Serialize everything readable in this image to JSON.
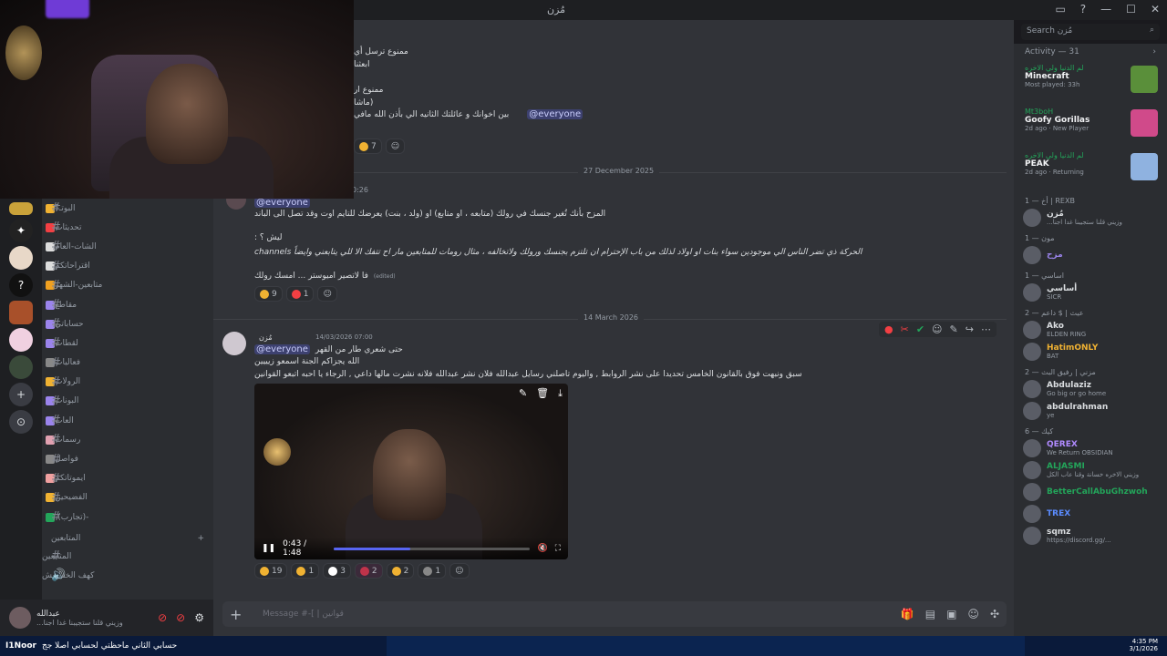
{
  "window": {
    "title": "مُزن",
    "search_placeholder": "Search مُزن"
  },
  "messages": {
    "m1_line1": "ممنوع ترسل أي",
    "m1_line2": "ابعثنا",
    "m1_line3": "ممنوع ار",
    "m1_line4": "(ماشا",
    "m1_line5": "بين اخوانك و عائلتك الثانيه الي بأذن الله مافي",
    "m1_mention": "@everyone",
    "m1_reaction_count": "7",
    "date1": "27 December 2025",
    "m2_time": "0:26",
    "m2_mention": "@everyone",
    "m2_line1": "المزح بأنك تُغير جنسك في رولك (متابعه ، او متابع) او (ولد ، بنت) يعرضك للتايم اوت وقد تصل الى الباند",
    "m2_line2": "ليش ؟ :",
    "m2_line3": "الحركة ذي تضر الناس الي موجودين سواء بنات او اولاد لذلك من باب الإحترام ان تلتزم بجنسك ورولك ولاتخالفه ، مثال رومات للمتابعين مار اح تتفك الا للي يتابعني وايضاً channels",
    "m2_line4": "فا لاتصير اميوستر ... امسك رولك",
    "m2_edited": "(edited)",
    "m2_reactions": [
      "9",
      "1"
    ],
    "date2": "14 March 2026",
    "m3_author": "مُزن",
    "m3_timestamp": "14/03/2026 07:00",
    "m3_line1": "حتى شعري طار من القهر",
    "m3_mention": "@everyone",
    "m3_line2": "الله يجزاكم الجنة اسمعو زيييين",
    "m3_line3": "سبق ونبهت فوق بالقانون الخامس تحديدا على نشر الروابط , واليوم تاصلني رسايل عبدالله فلان نشر عبدالله فلانه نشرت مالها داعي , الرجاء يا احبه اتبعو القوانين",
    "m3_reactions": [
      "19",
      "1",
      "3",
      "2",
      "2",
      "1"
    ]
  },
  "video": {
    "time": "0:43 / 1:48",
    "progress": 0.39
  },
  "composer": {
    "placeholder": "Message #-[ | قوانين"
  },
  "channels": [
    "البوتـ؟",
    "تحديثات",
    "الشات-العام",
    "اقتراحاتكم",
    "متابعين-الشهر",
    "مقاطع",
    "حساباتي",
    "لقطات",
    "فعاليات",
    "الرولات",
    "البونات",
    "العاب",
    "رسمات",
    "فواصل",
    "ايموتاتكم",
    "الفضيحين",
    "-(تجارب)-"
  ],
  "category": "المتابعين",
  "channels2": [
    "المتابعين",
    "كهف الخفافيش"
  ],
  "user": {
    "name": "عبدالله",
    "status": "...وزيني قلنا ستجيبنا غدا اجنا"
  },
  "sidebar": {
    "activity_header": "Activity — 31",
    "activities": [
      {
        "name": "لم الدنيا ولي الاخره",
        "game": "Minecraft",
        "meta": "Most played: 33h",
        "color": "#5a8f3a"
      },
      {
        "name": "Mt3boH",
        "game": "Goofy Gorillas",
        "meta": "2d ago · New Player",
        "color": "#d04a8a"
      },
      {
        "name": "لم الدنيا ولي الاخره",
        "game": "PEAK",
        "meta": "2d ago · Returning",
        "color": "#8fb2e0"
      }
    ],
    "roles": [
      {
        "label": "REXB | أخ — 1",
        "members": [
          {
            "name": "مُزن",
            "status": "...وزيني قلنا ستجيبنا غدا اجنا",
            "color": "#dbdee1"
          }
        ]
      },
      {
        "label": "مون — 1",
        "members": [
          {
            "name": "مزح",
            "status": "",
            "color": "#9b84ec"
          }
        ]
      },
      {
        "label": "اساسي — 1",
        "members": [
          {
            "name": "أساسي",
            "status": "SICR",
            "color": "#dbdee1"
          }
        ]
      },
      {
        "label": "عيث | $ داعم — 2",
        "members": [
          {
            "name": "Ako",
            "status": "ELDEN RING",
            "color": "#dbdee1"
          },
          {
            "name": "HatimONLY",
            "status": "BAT",
            "color": "#f0b232"
          }
        ]
      },
      {
        "label": "مزني | رفيق البث — 2",
        "members": [
          {
            "name": "Abdulaziz",
            "status": "Go big or go home",
            "color": "#dbdee1"
          },
          {
            "name": "abdulrahman",
            "status": "ye",
            "color": "#dbdee1"
          }
        ]
      },
      {
        "label": "كيك — 6",
        "members": [
          {
            "name": "QEREX",
            "status": "We Return OBSIDIAN",
            "color": "#b08aff"
          },
          {
            "name": "ALJASMI",
            "status": "وزيني الاخره خسانة وقنا عاب الكل",
            "color": "#23a55a"
          },
          {
            "name": "BetterCallAbuGhzwoh",
            "status": "",
            "color": "#23a55a"
          },
          {
            "name": "TREX",
            "status": "",
            "color": "#5b8cff"
          },
          {
            "name": "sqmz",
            "status": "https://discord.gg/...",
            "color": "#dbdee1"
          }
        ]
      }
    ]
  },
  "taskbar": {
    "app": "I1Noor",
    "title": "حسابي الثاني ماحظتي لحسابي اصلا جج",
    "time": "4:35 PM",
    "date": "3/1/2026"
  }
}
